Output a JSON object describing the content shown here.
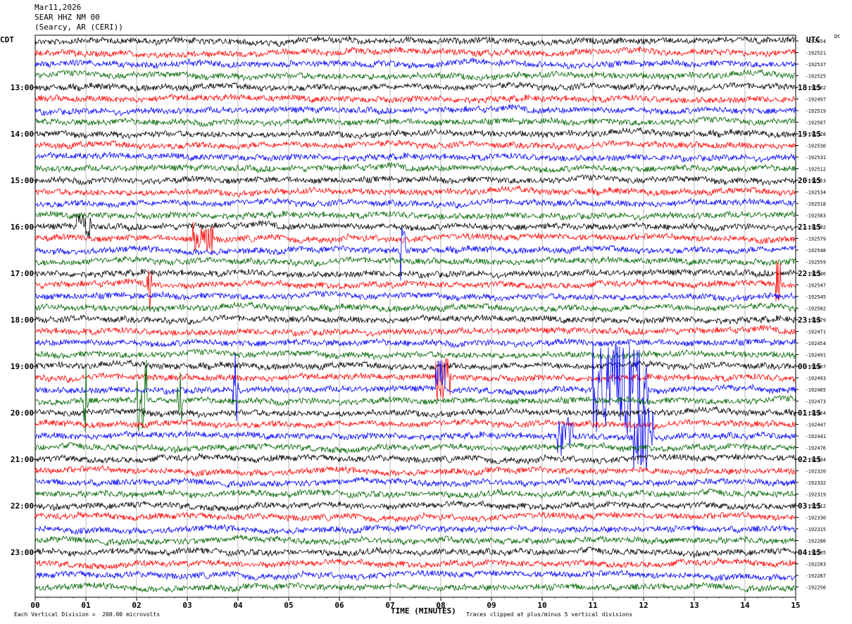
{
  "header": {
    "date": "Mar11,2026",
    "station": "SEAR HHZ NM 00",
    "location": "(Searcy, AR (CERI))"
  },
  "left_axis_label": "CDT",
  "right_axis_label": "UTC",
  "right_corner_label": "DC",
  "xlabel": "TIME (MINUTES)",
  "footer": {
    "scale_note": "Each Vertical Division =  200.00 microvolts",
    "clip_note": "Traces clipped at plus/minus 5 vertical divisions"
  },
  "colors": {
    "trace_cycle": [
      "#000000",
      "#ff0000",
      "#0000ff",
      "#006400"
    ],
    "grid": "#888888"
  },
  "chart_data": {
    "type": "line",
    "title": "",
    "xlim": [
      0,
      15
    ],
    "x_ticks": [
      "00",
      "01",
      "02",
      "03",
      "04",
      "05",
      "06",
      "07",
      "08",
      "09",
      "10",
      "11",
      "12",
      "13",
      "14",
      "15"
    ],
    "row_count": 48,
    "rows_per_hour": 4,
    "left_hour_labels": [
      "13:00",
      "14:00",
      "15:00",
      "16:00",
      "17:00",
      "18:00",
      "19:00",
      "20:00",
      "21:00",
      "22:00",
      "23:00"
    ],
    "right_hour_labels": [
      "18:15",
      "19:15",
      "20:15",
      "21:15",
      "22:15",
      "23:15",
      "00:15",
      "01:15",
      "02:15",
      "03:15",
      "04:15"
    ],
    "dc_offsets": [
      "-192554",
      "-192521",
      "-192537",
      "-192525",
      "-192502",
      "-192497",
      "-192519",
      "-192507",
      "-192528",
      "-192530",
      "-192531",
      "-192512",
      "-192553",
      "-192534",
      "-192518",
      "-192583",
      "-192592",
      "-192579",
      "-192548",
      "-192559",
      "-192536",
      "-192547",
      "-192545",
      "-192502",
      "-192479",
      "-192471",
      "-192454",
      "-192491",
      "-192467",
      "-192493",
      "-192465",
      "-192473",
      "-192464",
      "-192447",
      "-192441",
      "-192476",
      "-192334",
      "-192320",
      "-192332",
      "-192319",
      "-192312",
      "-192330",
      "-192315",
      "-192286",
      "-192295",
      "-192283",
      "-192287",
      "-192256"
    ],
    "events": [
      {
        "row": 16,
        "minute": 0.8,
        "amp": 1.2,
        "len": 0.3
      },
      {
        "row": 17,
        "minute": 3.1,
        "amp": 1.2,
        "len": 0.4
      },
      {
        "row": 18,
        "minute": 7.2,
        "amp": 2.8,
        "len": 0.1
      },
      {
        "row": 21,
        "minute": 2.2,
        "amp": 2.0,
        "len": 0.1
      },
      {
        "row": 21,
        "minute": 14.6,
        "amp": 2.5,
        "len": 0.1
      },
      {
        "row": 29,
        "minute": 7.9,
        "amp": 2.0,
        "len": 0.3
      },
      {
        "row": 30,
        "minute": 3.9,
        "amp": 3.5,
        "len": 0.1
      },
      {
        "row": 30,
        "minute": 7.9,
        "amp": 3.0,
        "len": 0.2
      },
      {
        "row": 30,
        "minute": 11.0,
        "amp": 4.0,
        "len": 1.1
      },
      {
        "row": 31,
        "minute": 0.95,
        "amp": 3.0,
        "len": 0.1
      },
      {
        "row": 31,
        "minute": 2.0,
        "amp": 3.5,
        "len": 0.2
      },
      {
        "row": 31,
        "minute": 2.8,
        "amp": 2.5,
        "len": 0.1
      },
      {
        "row": 34,
        "minute": 10.3,
        "amp": 2.0,
        "len": 0.3
      },
      {
        "row": 34,
        "minute": 11.8,
        "amp": 3.0,
        "len": 0.4
      }
    ]
  }
}
